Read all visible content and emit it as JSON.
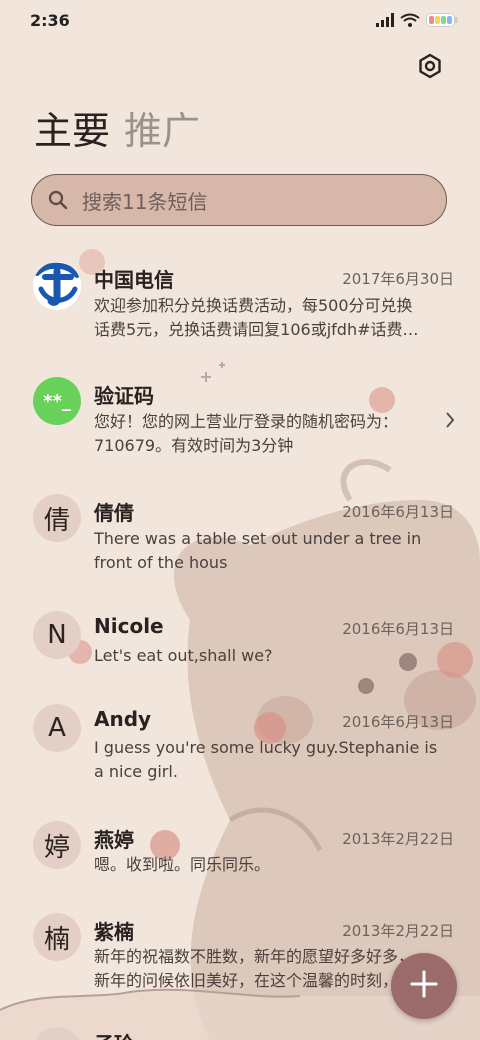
{
  "status_bar": {
    "time": "2:36"
  },
  "tabs": [
    {
      "label": "主要",
      "active": true
    },
    {
      "label": "推广",
      "active": false
    }
  ],
  "search": {
    "placeholder": "搜索11条短信"
  },
  "conversations": [
    {
      "avatar_text": "",
      "avatar_icon": "china-telecom-logo-icon",
      "name": "中国电信",
      "date": "2017年6月30日",
      "preview_lines": [
        "欢迎参加积分兑换话费活动，每500分可兑换",
        "话费5元，兑换话费请回复106或jfdh#话费…"
      ]
    },
    {
      "avatar_text": "**_",
      "name": "验证码",
      "date": "",
      "preview_lines": [
        "您好！您的网上营业厅登录的随机密码为：",
        "710679。有效时间为3分钟"
      ]
    },
    {
      "avatar_text": "倩",
      "name": "倩倩",
      "date": "2016年6月13日",
      "preview_lines": [
        "There was a table set out under a tree in",
        "front of the hous"
      ]
    },
    {
      "avatar_text": "N",
      "name": "Nicole",
      "date": "2016年6月13日",
      "preview_lines": [
        "Let's eat out,shall we?"
      ]
    },
    {
      "avatar_text": "A",
      "name": "Andy",
      "date": "2016年6月13日",
      "preview_lines": [
        "I guess you're some lucky guy.Stephanie is",
        "a nice girl."
      ]
    },
    {
      "avatar_text": "婷",
      "name": "燕婷",
      "date": "2013年2月22日",
      "preview_lines": [
        "嗯。收到啦。同乐同乐。"
      ]
    },
    {
      "avatar_text": "楠",
      "name": "紫楠",
      "date": "2013年2月22日",
      "preview_lines": [
        "新年的祝福数不胜数，新年的愿望好多好多，",
        "新年的问候依旧美好，在这个温馨的时刻，"
      ]
    },
    {
      "avatar_text": "",
      "name": "子玲",
      "date": "",
      "preview_lines": []
    }
  ],
  "colors": {
    "background": "#f2e6dc",
    "search_fill": "#d6b7aa",
    "fab": "#9c6b6b",
    "verification_avatar": "#68d15a",
    "telecom_blue": "#1a57b0"
  }
}
